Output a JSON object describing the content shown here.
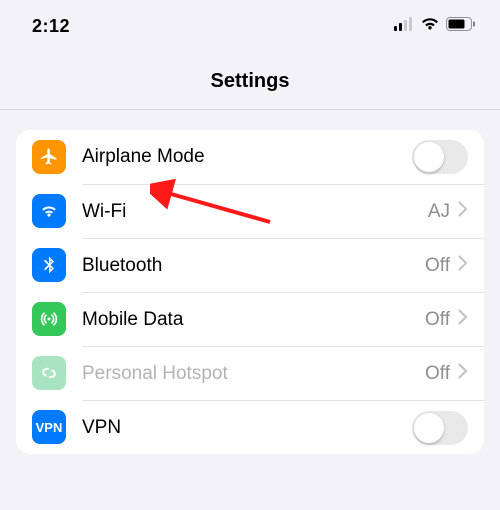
{
  "status": {
    "time": "2:12"
  },
  "header": {
    "title": "Settings"
  },
  "rows": {
    "airplane": {
      "label": "Airplane Mode"
    },
    "wifi": {
      "label": "Wi-Fi",
      "value": "AJ"
    },
    "bluetooth": {
      "label": "Bluetooth",
      "value": "Off"
    },
    "mobile": {
      "label": "Mobile Data",
      "value": "Off"
    },
    "hotspot": {
      "label": "Personal Hotspot",
      "value": "Off"
    },
    "vpn": {
      "label": "VPN",
      "icon_text": "VPN"
    }
  },
  "colors": {
    "orange": "#ff9500",
    "blue": "#007aff",
    "green": "#34c759",
    "mint": "#a8e4c1",
    "grey": "#8e8e93"
  }
}
